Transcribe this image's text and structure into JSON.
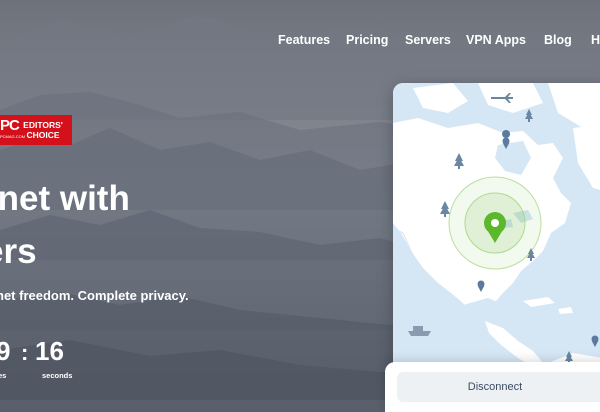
{
  "nav": {
    "items": [
      {
        "label": "Features"
      },
      {
        "label": "Pricing"
      },
      {
        "label": "Servers"
      },
      {
        "label": "VPN Apps"
      },
      {
        "label": "Blog"
      },
      {
        "label": "H"
      }
    ]
  },
  "badge": {
    "pc_text": "PC",
    "pc_subtext": "PCMAG.COM",
    "choice_line1": "EDITORS'",
    "choice_line2": "CHOICE"
  },
  "hero": {
    "headline_line1": "rnet with",
    "headline_line2": "ers",
    "subtitle": "net freedom. Complete privacy."
  },
  "countdown": {
    "minutes_value": "9",
    "separator": ":",
    "seconds_value": "16",
    "minutes_unit": "es",
    "seconds_unit": "seconds"
  },
  "app": {
    "disconnect_label": "Disconnect",
    "map_land_color": "#ffffff",
    "map_water_color": "#d5e6f5",
    "connected_color": "#5cb82a"
  }
}
